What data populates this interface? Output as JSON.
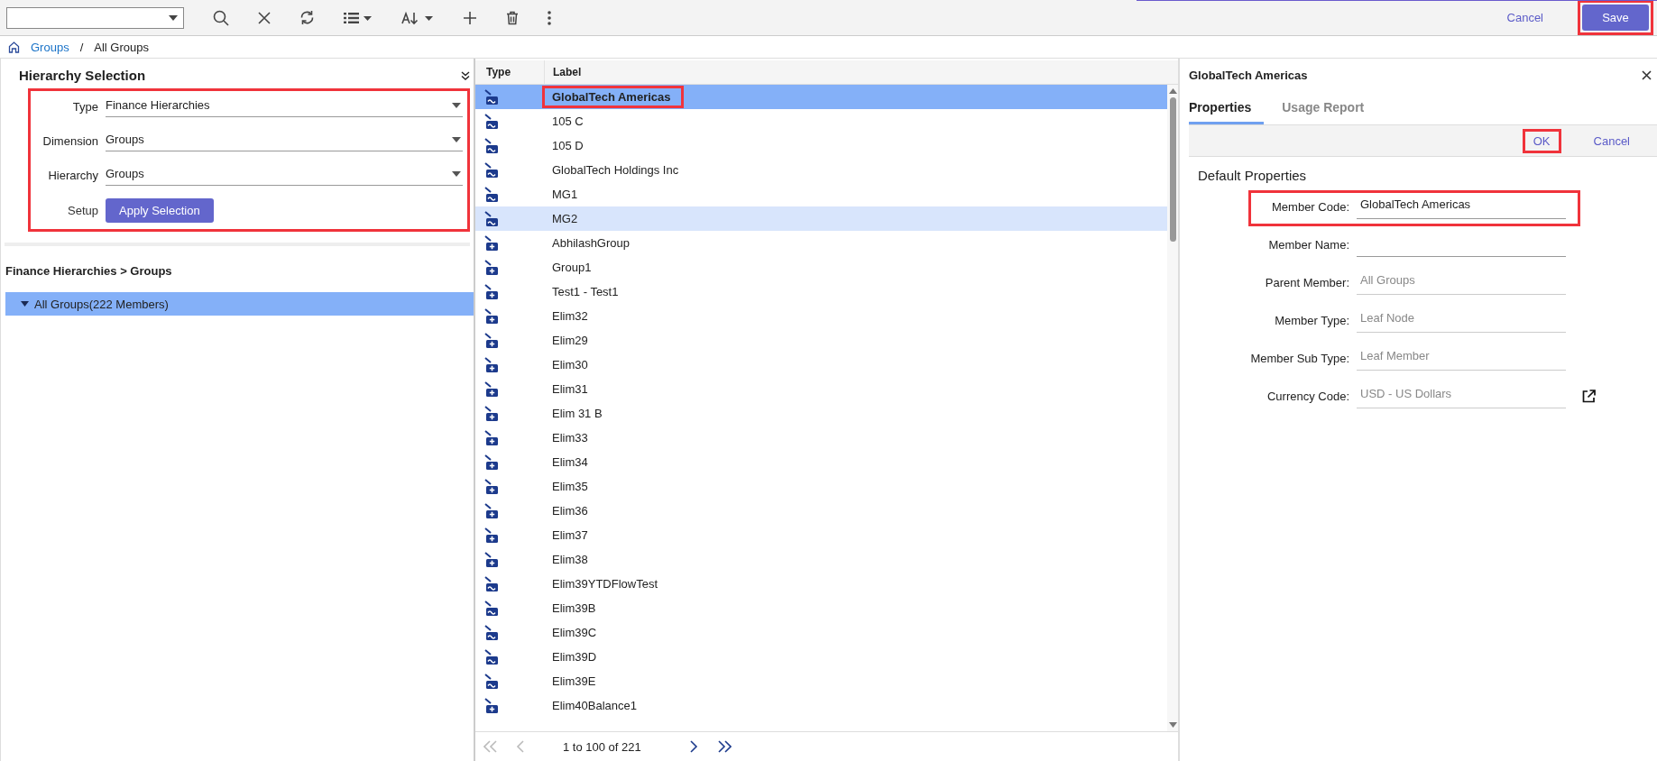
{
  "toolbar": {
    "cancel": "Cancel",
    "save": {
      "label": "Save",
      "highlighted": true
    }
  },
  "breadcrumb": {
    "items": [
      {
        "label": "Groups",
        "link": true
      },
      {
        "label": "All Groups",
        "link": false
      }
    ],
    "separator": "/"
  },
  "hierarchy_selection": {
    "title": "Hierarchy Selection",
    "highlighted": true,
    "fields": [
      {
        "label": "Type",
        "value": "Finance Hierarchies"
      },
      {
        "label": "Dimension",
        "value": "Groups"
      },
      {
        "label": "Hierarchy",
        "value": "Groups"
      }
    ],
    "setup": "Setup",
    "apply": "Apply Selection"
  },
  "path": "Finance Hierarchies > Groups",
  "tree": [
    {
      "label": "All Groups(222 Members)",
      "expanded": true,
      "selected": true
    }
  ],
  "members_table": {
    "columns": [
      "Type",
      "Label"
    ],
    "rows": [
      {
        "kind": "wave",
        "label": "GlobalTech Americas",
        "selected": true,
        "hovered": false,
        "highlighted": true
      },
      {
        "kind": "wave",
        "label": "105 C",
        "selected": false,
        "hovered": false,
        "highlighted": false
      },
      {
        "kind": "wave",
        "label": "105 D",
        "selected": false,
        "hovered": false,
        "highlighted": false
      },
      {
        "kind": "wave",
        "label": "GlobalTech Holdings Inc",
        "selected": false,
        "hovered": false,
        "highlighted": false
      },
      {
        "kind": "wave",
        "label": "MG1",
        "selected": false,
        "hovered": false,
        "highlighted": false
      },
      {
        "kind": "wave",
        "label": "MG2",
        "selected": false,
        "hovered": true,
        "highlighted": false
      },
      {
        "kind": "plus",
        "label": "AbhilashGroup",
        "selected": false,
        "hovered": false,
        "highlighted": false
      },
      {
        "kind": "plus",
        "label": "Group1",
        "selected": false,
        "hovered": false,
        "highlighted": false
      },
      {
        "kind": "plus",
        "label": "Test1 - Test1",
        "selected": false,
        "hovered": false,
        "highlighted": false
      },
      {
        "kind": "plus",
        "label": "Elim32",
        "selected": false,
        "hovered": false,
        "highlighted": false
      },
      {
        "kind": "plus",
        "label": "Elim29",
        "selected": false,
        "hovered": false,
        "highlighted": false
      },
      {
        "kind": "plus",
        "label": "Elim30",
        "selected": false,
        "hovered": false,
        "highlighted": false
      },
      {
        "kind": "plus",
        "label": "Elim31",
        "selected": false,
        "hovered": false,
        "highlighted": false
      },
      {
        "kind": "plus",
        "label": "Elim 31 B",
        "selected": false,
        "hovered": false,
        "highlighted": false
      },
      {
        "kind": "plus",
        "label": "Elim33",
        "selected": false,
        "hovered": false,
        "highlighted": false
      },
      {
        "kind": "plus",
        "label": "Elim34",
        "selected": false,
        "hovered": false,
        "highlighted": false
      },
      {
        "kind": "plus",
        "label": "Elim35",
        "selected": false,
        "hovered": false,
        "highlighted": false
      },
      {
        "kind": "plus",
        "label": "Elim36",
        "selected": false,
        "hovered": false,
        "highlighted": false
      },
      {
        "kind": "plus",
        "label": "Elim37",
        "selected": false,
        "hovered": false,
        "highlighted": false
      },
      {
        "kind": "plus",
        "label": "Elim38",
        "selected": false,
        "hovered": false,
        "highlighted": false
      },
      {
        "kind": "wave",
        "label": "Elim39YTDFlowTest",
        "selected": false,
        "hovered": false,
        "highlighted": false
      },
      {
        "kind": "wave",
        "label": "Elim39B",
        "selected": false,
        "hovered": false,
        "highlighted": false
      },
      {
        "kind": "wave",
        "label": "Elim39C",
        "selected": false,
        "hovered": false,
        "highlighted": false
      },
      {
        "kind": "wave",
        "label": "Elim39D",
        "selected": false,
        "hovered": false,
        "highlighted": false
      },
      {
        "kind": "wave",
        "label": "Elim39E",
        "selected": false,
        "hovered": false,
        "highlighted": false
      },
      {
        "kind": "plus",
        "label": "Elim40Balance1",
        "selected": false,
        "hovered": false,
        "highlighted": false
      }
    ],
    "pagination": {
      "text": "1 to 100 of 221",
      "buttons": [
        {
          "kind": "first",
          "disabled": true
        },
        {
          "kind": "previous",
          "disabled": true
        },
        {
          "kind": "next",
          "disabled": false
        },
        {
          "kind": "last",
          "disabled": false
        }
      ]
    }
  },
  "details": {
    "title": "GlobalTech Americas",
    "tabs": [
      {
        "label": "Properties",
        "selected": true
      },
      {
        "label": "Usage Report",
        "selected": false
      }
    ],
    "ok": {
      "label": "OK",
      "highlighted": true
    },
    "cancel": "Cancel",
    "section": "Default Properties",
    "fields": [
      {
        "label": "Member Code:",
        "value": "GlobalTech Americas",
        "editable": true,
        "highlighted": true,
        "external_link": false
      },
      {
        "label": "Member Name:",
        "editable": true,
        "highlighted": false,
        "external_link": false
      },
      {
        "label": "Parent Member:",
        "value": "All Groups",
        "editable": false,
        "highlighted": false,
        "external_link": false
      },
      {
        "label": "Member Type:",
        "value": "Leaf Node",
        "editable": false,
        "highlighted": false,
        "external_link": false
      },
      {
        "label": "Member Sub Type:",
        "value": "Leaf Member",
        "editable": false,
        "highlighted": false,
        "external_link": false
      },
      {
        "label": "Currency Code:",
        "value": "USD - US Dollars",
        "editable": false,
        "highlighted": false,
        "external_link": true
      }
    ]
  }
}
